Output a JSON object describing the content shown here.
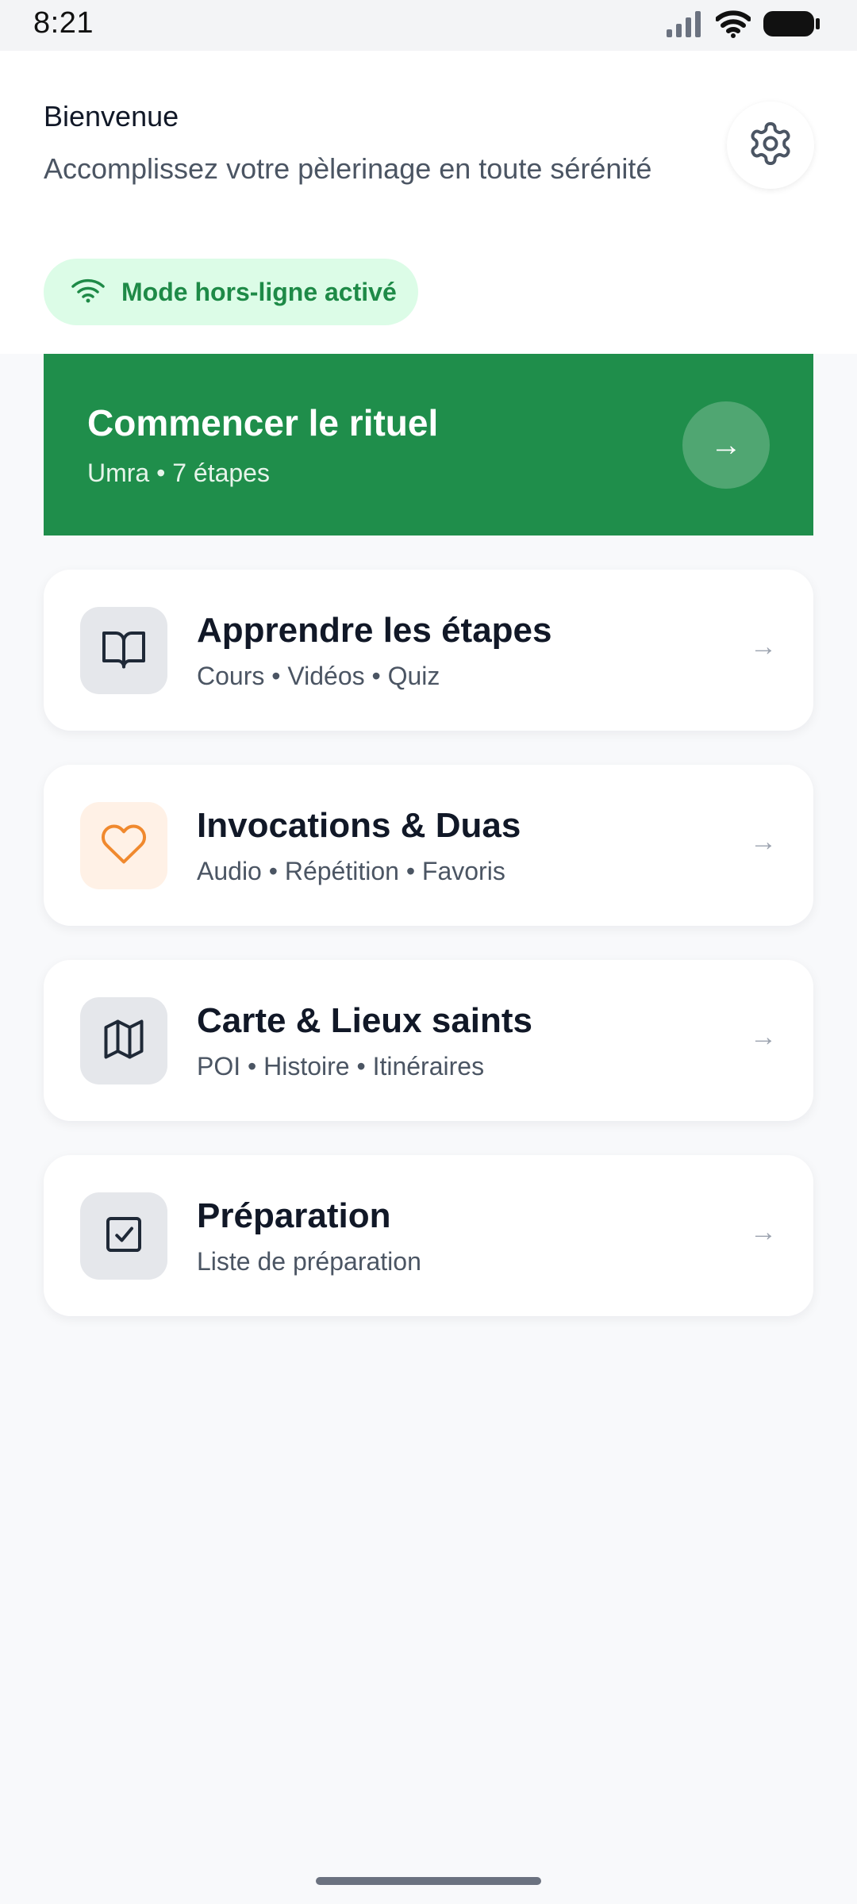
{
  "status_bar": {
    "time": "8:21"
  },
  "header": {
    "greeting": "Bienvenue",
    "subtitle": "Accomplissez votre pèlerinage en toute sérénité",
    "offline_label": "Mode hors-ligne activé"
  },
  "ritual": {
    "title": "Commencer le rituel",
    "subtitle": "Umra • 7 étapes",
    "arrow": "→"
  },
  "cards": [
    {
      "title": "Apprendre les étapes",
      "subtitle": "Cours • Vidéos • Quiz",
      "icon": "book-icon",
      "arrow": "→"
    },
    {
      "title": "Invocations & Duas",
      "subtitle": "Audio • Répétition • Favoris",
      "icon": "heart-icon",
      "arrow": "→"
    },
    {
      "title": "Carte & Lieux saints",
      "subtitle": "POI • Histoire • Itinéraires",
      "icon": "map-icon",
      "arrow": "→"
    },
    {
      "title": "Préparation",
      "subtitle": "Liste de préparation",
      "icon": "checkbox-icon",
      "arrow": "→"
    }
  ],
  "colors": {
    "brand_green": "#1f8e4b",
    "offline_bg": "#dcfce7",
    "offline_text": "#1e8a47",
    "heart_orange": "#f0892e"
  }
}
